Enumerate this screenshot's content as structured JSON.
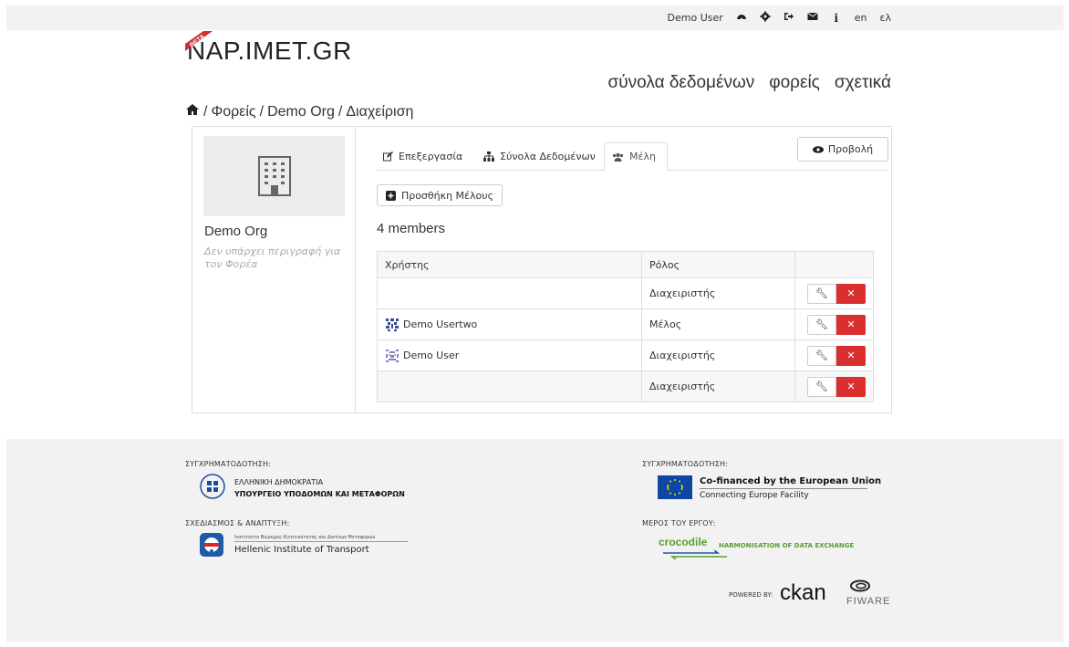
{
  "account": {
    "user_name": "Demo User",
    "icons": [
      "dashboard-icon",
      "settings-icon",
      "logout-icon",
      "envelope-icon",
      "info-icon"
    ],
    "lang_en": "en",
    "lang_el": "ελ"
  },
  "site": {
    "logo_text": "NAP.IMET.GR",
    "beta_badge": "BETA",
    "nav": [
      "σύνολα δεδομένων",
      "φορείς",
      "σχετικά"
    ]
  },
  "breadcrumb": {
    "items": [
      "Φορείς",
      "Demo Org",
      "Διαχείριση"
    ]
  },
  "org": {
    "name": "Demo Org",
    "description": "Δεν υπάρχει περιγραφή για τον Φορέα"
  },
  "tabs": {
    "edit": "Επεξεργασία",
    "datasets": "Σύνολα Δεδομένων",
    "members": "Μέλη",
    "active": "members"
  },
  "actions": {
    "view_label": "Προβολή",
    "add_member_label": "Προσθήκη Μέλους"
  },
  "members": {
    "count_text": "4 members",
    "headers": [
      "Χρήστης",
      "Ρόλος",
      ""
    ],
    "rows": [
      {
        "user": "",
        "role": "Διαχειριστής",
        "avatar": false
      },
      {
        "user": "Demo Usertwo",
        "role": "Μέλος",
        "avatar": true
      },
      {
        "user": "Demo User",
        "role": "Διαχειριστής",
        "avatar": true
      },
      {
        "user": "",
        "role": "Διαχειριστής",
        "avatar": false
      }
    ]
  },
  "footer": {
    "cofunding_label_left": "ΣΥΓΧΡΗΜΑΤΟΔΟΤΗΣΗ:",
    "hellenic_republic": "ΕΛΛΗΝΙΚΗ ΔΗΜΟΚΡΑΤΙΑ",
    "ministry": "ΥΠΟΥΡΓΕΙΟ ΥΠΟΔΟΜΩΝ ΚΑΙ ΜΕΤΑΦΟΡΩΝ",
    "design_label": "ΣΧΕΔΙΑΣΜΟΣ & ΑΝΑΠΤΥΞΗ:",
    "hit_small": "Ινστιτούτο Βιώσιμης Κινητικότητας και Δικτύων Μεταφορών",
    "hit_name": "Hellenic Institute of Transport",
    "cofunding_label_right": "ΣΥΓΧΡΗΜΑΤΟΔΟΤΗΣΗ:",
    "eu_line1": "Co-financed by the European Union",
    "eu_line2": "Connecting Europe Facility",
    "part_label": "ΜΕΡΟΣ ΤΟΥ ΕΡΓΟΥ:",
    "crocodile": "crocodile",
    "crocodile_tag": "HARMONISATION OF DATA EXCHANGE",
    "powered_by": "POWERED BY:",
    "ckan": "ckan",
    "fiware": "FIWARE"
  },
  "colors": {
    "danger": "#d9302f",
    "eu_blue": "#0e47a1",
    "crocodile_green": "#5a9e2f",
    "footer_bg": "#f2f2f2"
  }
}
